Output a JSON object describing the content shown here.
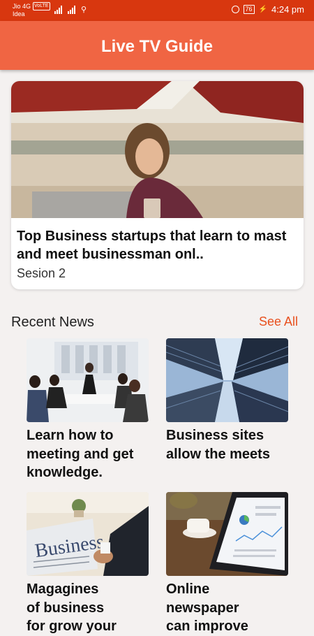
{
  "status_bar": {
    "carrier": "Jio 4G",
    "volte": "VoLTE",
    "carrier2": "Idea",
    "battery": "76",
    "time": "4:24 pm"
  },
  "app_bar": {
    "title": "Live TV Guide"
  },
  "featured": {
    "title": "Top Business startups that learn to mast\nand meet businessman onl..",
    "subtitle": "Sesion 2"
  },
  "recent_news": {
    "heading": "Recent News",
    "see_all": "See All",
    "items": [
      {
        "title": "Learn how to\nmeeting and get\nknowledge."
      },
      {
        "title": "Business sites\nallow the meets"
      },
      {
        "title": "Magagines\nof business\nfor grow your"
      },
      {
        "title": "Online\nnewspaper\ncan improve"
      }
    ]
  },
  "images": {
    "newspaper_text": "Business"
  },
  "colors": {
    "status_bar": "#d8370f",
    "app_bar": "#f06543",
    "accent": "#e8501e",
    "background": "#f4f1f0"
  }
}
